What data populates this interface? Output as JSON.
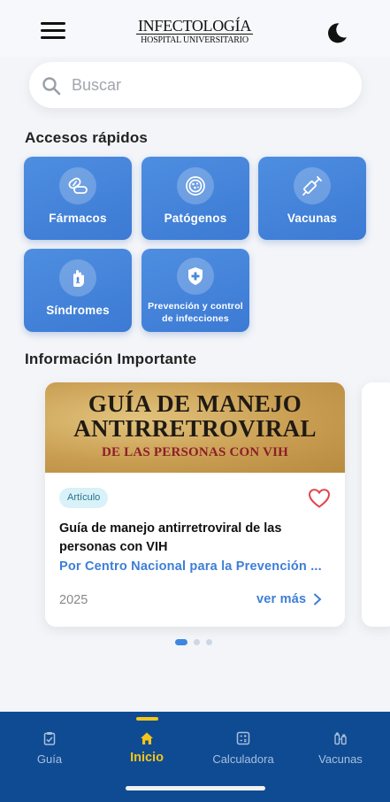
{
  "header": {
    "logo_title": "INFECTOLOGÍA",
    "logo_subtitle": "HOSPITAL UNIVERSITARIO"
  },
  "search": {
    "placeholder": "Buscar",
    "value": ""
  },
  "quick_access": {
    "title": "Accesos rápidos",
    "items": [
      {
        "label": "Fármacos",
        "icon": "pill-icon"
      },
      {
        "label": "Patógenos",
        "icon": "bacteria-icon"
      },
      {
        "label": "Vacunas",
        "icon": "syringe-icon"
      },
      {
        "label": "Síndromes",
        "icon": "hand-ribbon-icon"
      },
      {
        "label": "Prevención y control de infecciones",
        "icon": "shield-plus-icon"
      }
    ]
  },
  "important": {
    "title": "Información Importante",
    "card": {
      "banner_line1": "GUÍA DE MANEJO",
      "banner_line2": "ANTIRRETROVIRAL",
      "banner_line3": "DE LAS PERSONAS CON VIH",
      "badge": "Artículo",
      "title": "Guía de manejo antirretroviral de las personas con VIH",
      "author": "Por Centro Nacional para la Prevención ...",
      "year": "2025",
      "more_label": "ver más"
    },
    "carousel": {
      "count": 3,
      "active": 1
    }
  },
  "bottom_nav": {
    "items": [
      {
        "label": "Guía",
        "icon": "clipboard-check-icon"
      },
      {
        "label": "Inicio",
        "icon": "home-icon"
      },
      {
        "label": "Calculadora",
        "icon": "calculator-icon"
      },
      {
        "label": "Vacunas",
        "icon": "vials-icon"
      }
    ],
    "active": "Inicio"
  },
  "colors": {
    "accent": "#3d7ed8",
    "tile": "#4a88dd",
    "nav_bg": "#0f4b93",
    "nav_active": "#f5c518",
    "heart": "#e0454f"
  }
}
